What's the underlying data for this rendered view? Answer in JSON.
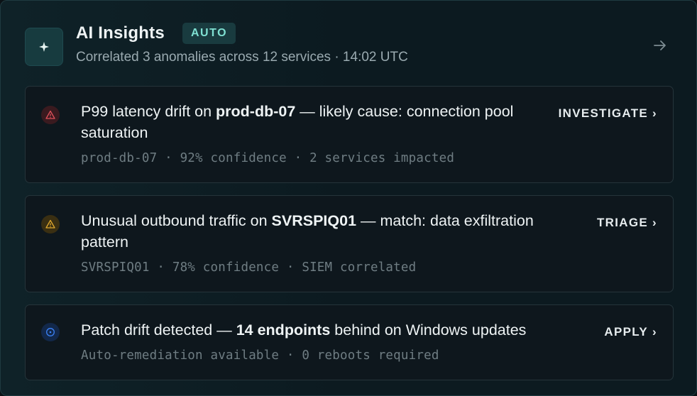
{
  "header": {
    "title": "AI Insights",
    "badge": "AUTO",
    "subtitle": "Correlated 3 anomalies across 12 services · 14:02 UTC",
    "icons": {
      "lead": "sparkle-icon",
      "open": "arrow-right-icon"
    }
  },
  "insights": [
    {
      "severity": "critical",
      "icon": "alert-triangle-icon",
      "color": "#e0505a",
      "title_pre": "P99 latency drift on ",
      "title_bold": "prod-db-07",
      "title_post": " — likely cause: connection pool saturation",
      "meta": "prod-db-07 · 92% confidence · 2 services impacted",
      "action": "INVESTIGATE",
      "chevron": "›"
    },
    {
      "severity": "warning",
      "icon": "alert-triangle-icon",
      "color": "#e0a82e",
      "title_pre": "Unusual outbound traffic on ",
      "title_bold": "SVRSPIQ01",
      "title_post": " — match: data exfiltration pattern",
      "meta": "SVRSPIQ01 · 78% confidence · SIEM correlated",
      "action": "TRIAGE",
      "chevron": "›"
    },
    {
      "severity": "info",
      "icon": "info-circle-icon",
      "color": "#3b82f6",
      "title_pre": "Patch drift detected — ",
      "title_bold": "14 endpoints",
      "title_post": " behind on Windows updates",
      "meta": "Auto-remediation available · 0 reboots required",
      "action": "APPLY",
      "chevron": "›"
    }
  ]
}
